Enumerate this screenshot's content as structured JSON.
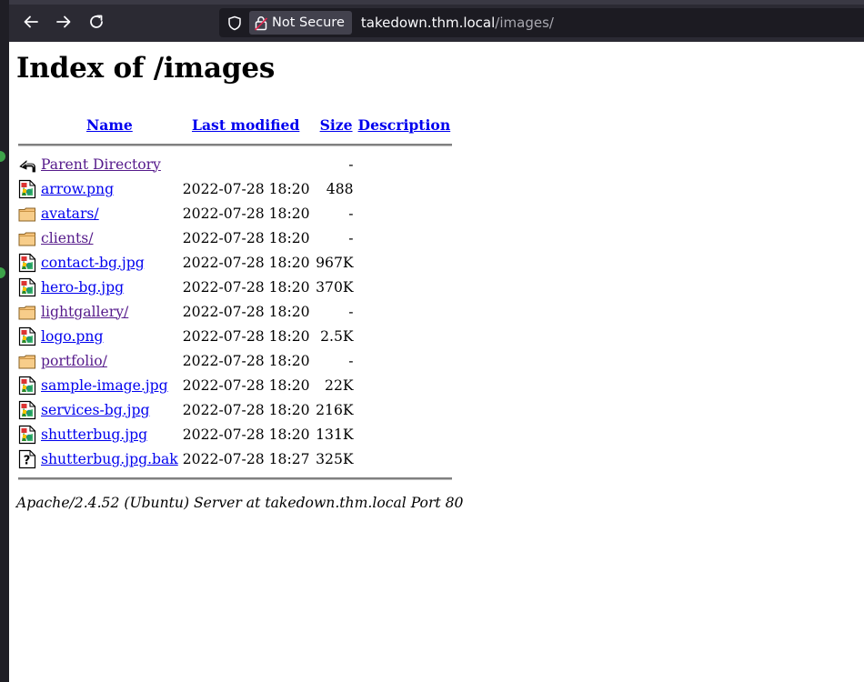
{
  "browser": {
    "security_label": "Not Secure",
    "url_host": "takedown.thm.local",
    "url_path": "/images/"
  },
  "page": {
    "title": "Index of /images",
    "columns": {
      "name": "Name",
      "modified": "Last modified",
      "size": "Size",
      "description": "Description"
    },
    "rows": [
      {
        "name": "Parent Directory",
        "modified": "",
        "size": "-",
        "icon": "back-icon",
        "visited": true
      },
      {
        "name": "arrow.png",
        "modified": "2022-07-28 18:20",
        "size": "488",
        "icon": "image-file-icon",
        "visited": false
      },
      {
        "name": "avatars/",
        "modified": "2022-07-28 18:20",
        "size": "-",
        "icon": "folder-icon",
        "visited": false
      },
      {
        "name": "clients/",
        "modified": "2022-07-28 18:20",
        "size": "-",
        "icon": "folder-icon",
        "visited": true
      },
      {
        "name": "contact-bg.jpg",
        "modified": "2022-07-28 18:20",
        "size": "967K",
        "icon": "image-file-icon",
        "visited": false
      },
      {
        "name": "hero-bg.jpg",
        "modified": "2022-07-28 18:20",
        "size": "370K",
        "icon": "image-file-icon",
        "visited": false
      },
      {
        "name": "lightgallery/",
        "modified": "2022-07-28 18:20",
        "size": "-",
        "icon": "folder-icon",
        "visited": true
      },
      {
        "name": "logo.png",
        "modified": "2022-07-28 18:20",
        "size": "2.5K",
        "icon": "image-file-icon",
        "visited": false
      },
      {
        "name": "portfolio/",
        "modified": "2022-07-28 18:20",
        "size": "-",
        "icon": "folder-icon",
        "visited": true
      },
      {
        "name": "sample-image.jpg",
        "modified": "2022-07-28 18:20",
        "size": "22K",
        "icon": "image-file-icon",
        "visited": false
      },
      {
        "name": "services-bg.jpg",
        "modified": "2022-07-28 18:20",
        "size": "216K",
        "icon": "image-file-icon",
        "visited": false
      },
      {
        "name": "shutterbug.jpg",
        "modified": "2022-07-28 18:20",
        "size": "131K",
        "icon": "image-file-icon",
        "visited": false
      },
      {
        "name": "shutterbug.jpg.bak",
        "modified": "2022-07-28 18:27",
        "size": "325K",
        "icon": "unknown-file-icon",
        "visited": false
      }
    ],
    "footer": "Apache/2.4.52 (Ubuntu) Server at takedown.thm.local Port 80"
  },
  "colors": {
    "link": "#0000ee",
    "visited": "#551a8b",
    "browser_chrome": "#2b2a33",
    "url_bar": "#1c1b22"
  }
}
